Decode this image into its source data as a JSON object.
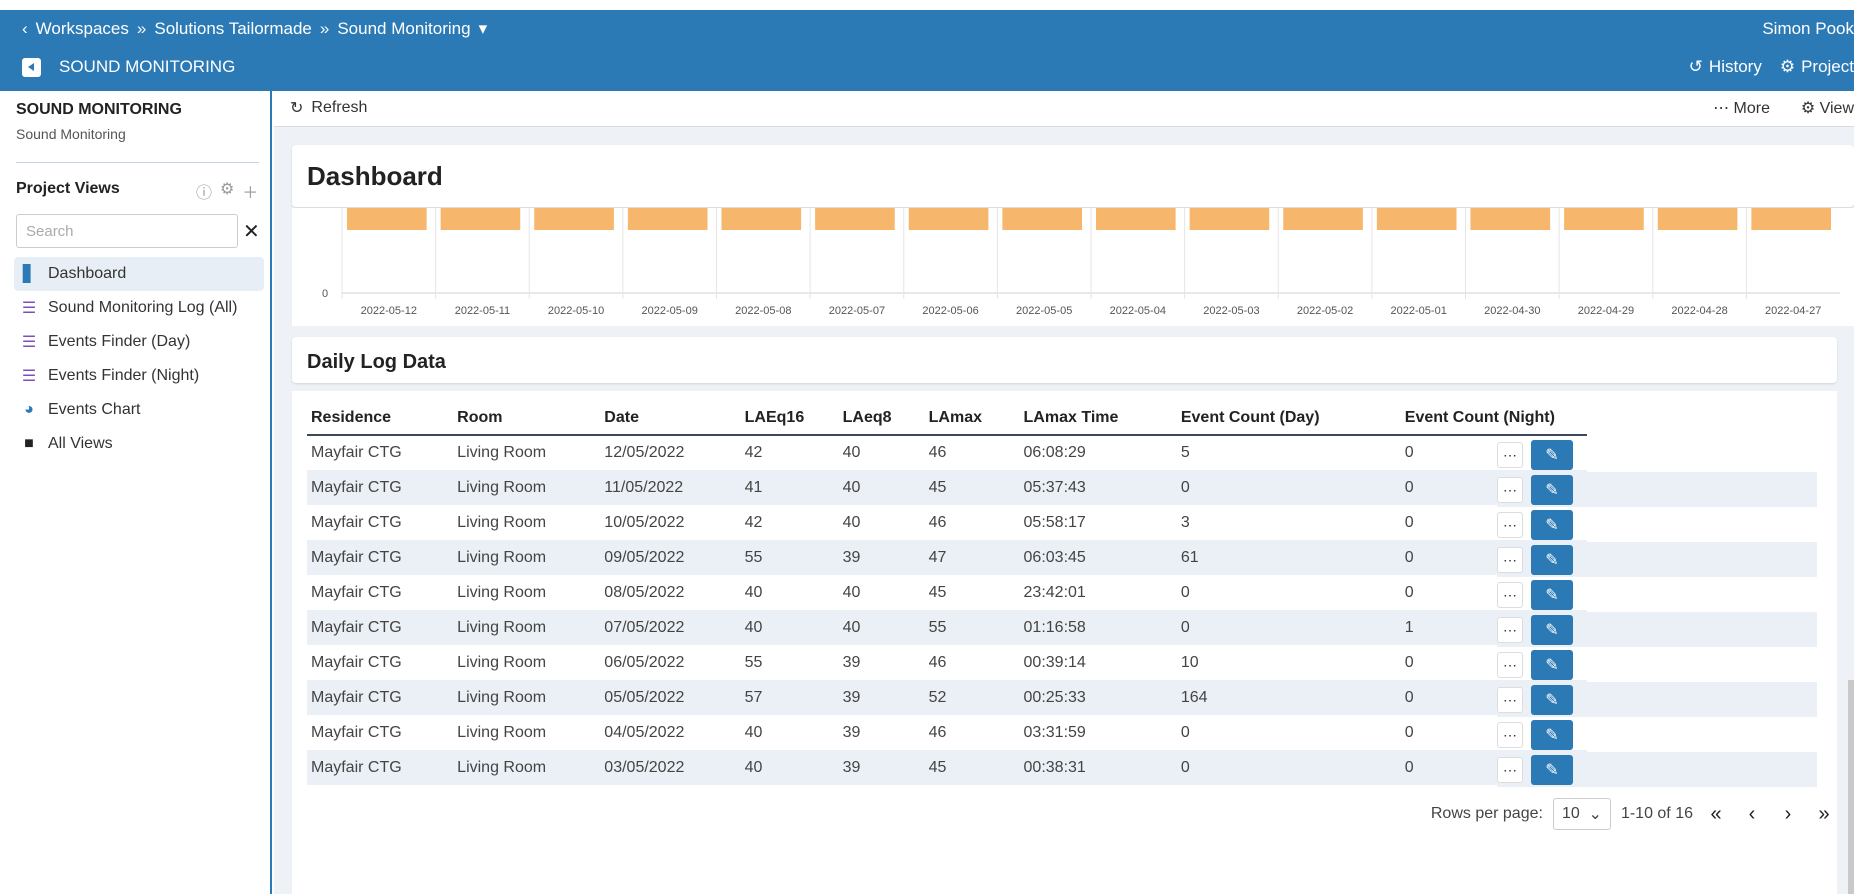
{
  "topbar": {
    "breadcrumbs": [
      "Workspaces",
      "Solutions Tailormade",
      "Sound Monitoring"
    ],
    "user": "Simon Pook",
    "app_name": "SOUND MONITORING",
    "history_label": "History",
    "project_label": "Project"
  },
  "sidebar": {
    "title": "SOUND MONITORING",
    "subtitle": "Sound Monitoring",
    "project_views_label": "Project Views",
    "search_placeholder": "Search",
    "items": [
      {
        "label": "Dashboard",
        "icon": "bar-chart-icon"
      },
      {
        "label": "Sound Monitoring Log (All)",
        "icon": "list-icon"
      },
      {
        "label": "Events Finder (Day)",
        "icon": "list-icon"
      },
      {
        "label": "Events Finder (Night)",
        "icon": "list-icon"
      },
      {
        "label": "Events Chart",
        "icon": "pie-chart-icon"
      },
      {
        "label": "All Views",
        "icon": "folder-icon"
      }
    ]
  },
  "toolbar": {
    "refresh_label": "Refresh",
    "more_label": "More",
    "view_label": "View"
  },
  "dashboard": {
    "title": "Dashboard"
  },
  "chart_data": {
    "type": "bar",
    "categories": [
      "2022-05-12",
      "2022-05-11",
      "2022-05-10",
      "2022-05-09",
      "2022-05-08",
      "2022-05-07",
      "2022-05-06",
      "2022-05-05",
      "2022-05-04",
      "2022-05-03",
      "2022-05-02",
      "2022-05-01",
      "2022-04-30",
      "2022-04-29",
      "2022-04-28",
      "2022-04-27"
    ],
    "y_ticks": [
      "0"
    ],
    "bar_color": "#f6b66b"
  },
  "log": {
    "title": "Daily Log Data",
    "columns": [
      "Residence",
      "Room",
      "Date",
      "LAEq16",
      "LAeq8",
      "LAmax",
      "LAmax Time",
      "Event Count (Day)",
      "Event Count (Night)"
    ],
    "rows": [
      [
        "Mayfair CTG",
        "Living Room",
        "12/05/2022",
        "42",
        "40",
        "46",
        "06:08:29",
        "5",
        "0"
      ],
      [
        "Mayfair CTG",
        "Living Room",
        "11/05/2022",
        "41",
        "40",
        "45",
        "05:37:43",
        "0",
        "0"
      ],
      [
        "Mayfair CTG",
        "Living Room",
        "10/05/2022",
        "42",
        "40",
        "46",
        "05:58:17",
        "3",
        "0"
      ],
      [
        "Mayfair CTG",
        "Living Room",
        "09/05/2022",
        "55",
        "39",
        "47",
        "06:03:45",
        "61",
        "0"
      ],
      [
        "Mayfair CTG",
        "Living Room",
        "08/05/2022",
        "40",
        "40",
        "45",
        "23:42:01",
        "0",
        "0"
      ],
      [
        "Mayfair CTG",
        "Living Room",
        "07/05/2022",
        "40",
        "40",
        "55",
        "01:16:58",
        "0",
        "1"
      ],
      [
        "Mayfair CTG",
        "Living Room",
        "06/05/2022",
        "55",
        "39",
        "46",
        "00:39:14",
        "10",
        "0"
      ],
      [
        "Mayfair CTG",
        "Living Room",
        "05/05/2022",
        "57",
        "39",
        "52",
        "00:25:33",
        "164",
        "0"
      ],
      [
        "Mayfair CTG",
        "Living Room",
        "04/05/2022",
        "40",
        "39",
        "46",
        "03:31:59",
        "0",
        "0"
      ],
      [
        "Mayfair CTG",
        "Living Room",
        "03/05/2022",
        "40",
        "39",
        "45",
        "00:38:31",
        "0",
        "0"
      ]
    ],
    "pager": {
      "rows_per_page_label": "Rows per page:",
      "rows_per_page": "10",
      "range": "1-10 of 16"
    }
  }
}
